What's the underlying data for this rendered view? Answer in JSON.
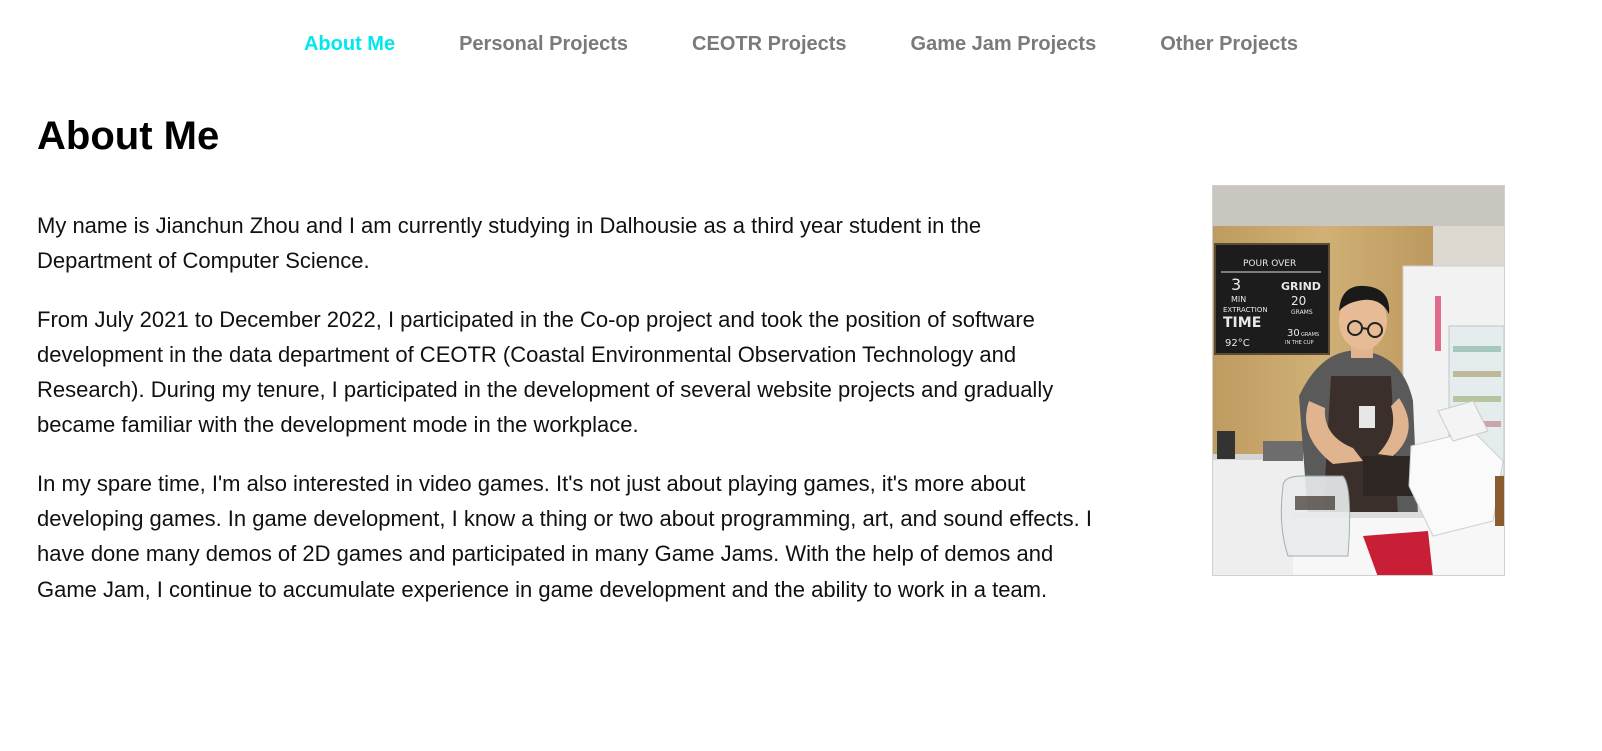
{
  "nav": {
    "items": [
      {
        "label": "About Me",
        "active": true
      },
      {
        "label": "Personal Projects",
        "active": false
      },
      {
        "label": "CEOTR Projects",
        "active": false
      },
      {
        "label": "Game Jam Projects",
        "active": false
      },
      {
        "label": "Other Projects",
        "active": false
      }
    ],
    "active_color": "#00e8ee",
    "inactive_color": "#7a7a7a"
  },
  "page": {
    "title": "About Me",
    "paragraphs": [
      "My name is Jianchun Zhou and I am currently studying in Dalhousie as a third year student in the Department of Computer Science.",
      "From July 2021 to December 2022, I participated in the Co-op project and took the position of software development in the data department of CEOTR (Coastal Environmental Observation Technology and Research). During my tenure, I participated in the development of several website projects and gradually became familiar with the development mode in the workplace.",
      "In my spare time, I'm also interested in video games. It's not just about playing games, it's more about developing games. In game development, I know a thing or two about programming, art, and sound effects. I have done many demos of 2D games and participated in many Game Jams. With the help of demos and Game Jam, I continue to accumulate experience in game development and the ability to work in a team."
    ]
  },
  "photo": {
    "chalkboard_text": [
      "3",
      "MIN",
      "EXTRACTION",
      "TIME",
      "GRIND",
      "20",
      "GRAMS",
      "92°C",
      "30",
      "GRAMS",
      "IN THE CUP"
    ]
  }
}
